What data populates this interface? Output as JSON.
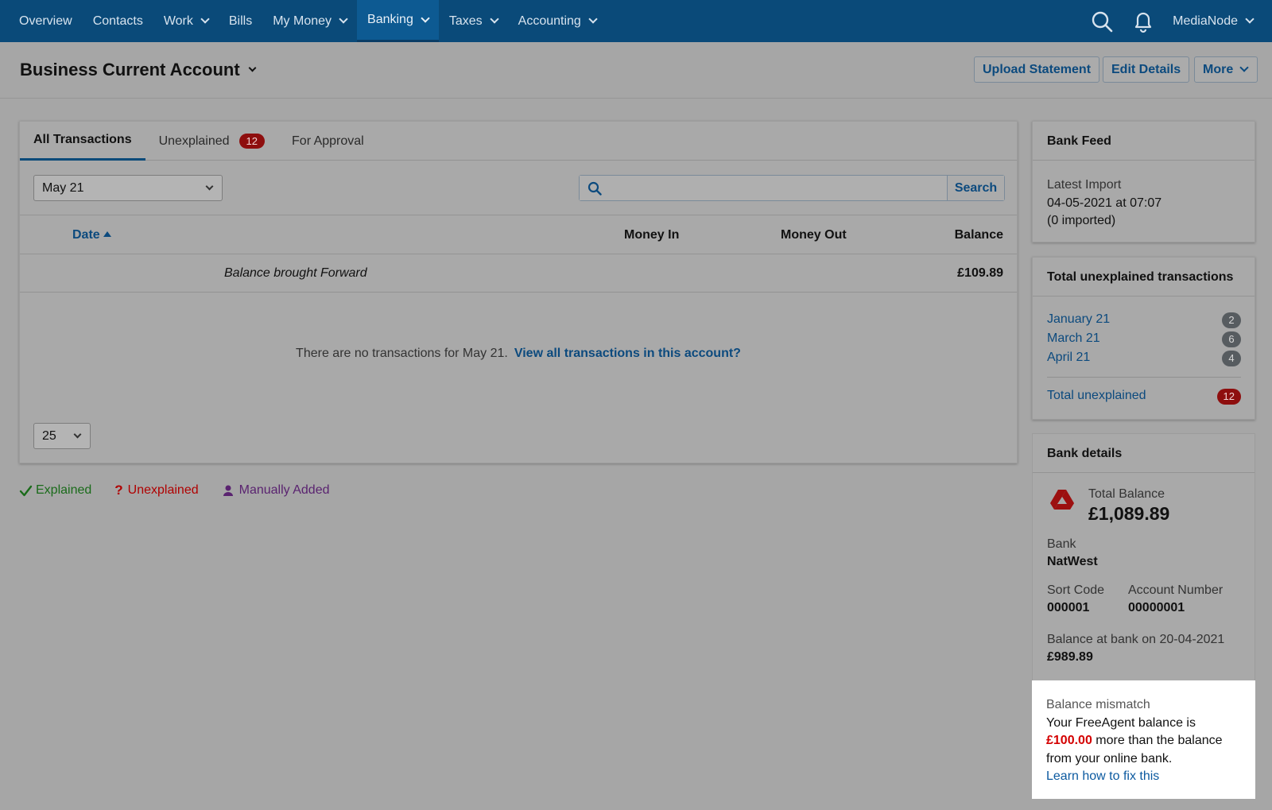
{
  "nav": {
    "items": [
      {
        "label": "Overview",
        "dropdown": false
      },
      {
        "label": "Contacts",
        "dropdown": false
      },
      {
        "label": "Work",
        "dropdown": true
      },
      {
        "label": "Bills",
        "dropdown": false
      },
      {
        "label": "My Money",
        "dropdown": true
      },
      {
        "label": "Banking",
        "dropdown": true,
        "active": true
      },
      {
        "label": "Taxes",
        "dropdown": true
      },
      {
        "label": "Accounting",
        "dropdown": true
      }
    ],
    "user": "MediaNode",
    "icons": [
      "search-icon",
      "bell-icon"
    ]
  },
  "header": {
    "title": "Business Current Account",
    "buttons": {
      "upload": "Upload Statement",
      "edit": "Edit Details",
      "more": "More"
    }
  },
  "tabs": {
    "all": "All Transactions",
    "unexplained": "Unexplained",
    "unexplained_count": "12",
    "approval": "For Approval"
  },
  "filters": {
    "month": "May 21",
    "search_placeholder": "",
    "search_button": "Search"
  },
  "table": {
    "columns": {
      "date": "Date",
      "money_in": "Money In",
      "money_out": "Money Out",
      "balance": "Balance"
    },
    "brought_forward_label": "Balance brought Forward",
    "brought_forward_value": "£109.89",
    "empty_text": "There are no transactions for May 21.",
    "empty_link": "View all transactions in this account?",
    "per_page": "25"
  },
  "legend": {
    "explained": "Explained",
    "unexplained": "Unexplained",
    "manual": "Manually Added"
  },
  "bank_feed": {
    "title": "Bank Feed",
    "latest_label": "Latest Import",
    "latest_value": "04-05-2021 at 07:07",
    "imported": "(0 imported)"
  },
  "unexplained": {
    "title": "Total unexplained transactions",
    "rows": [
      {
        "label": "January 21",
        "count": "2"
      },
      {
        "label": "March 21",
        "count": "6"
      },
      {
        "label": "April 21",
        "count": "4"
      }
    ],
    "total_label": "Total unexplained",
    "total_count": "12"
  },
  "bank_details": {
    "title": "Bank details",
    "total_balance_label": "Total Balance",
    "total_balance": "£1,089.89",
    "bank_label": "Bank",
    "bank": "NatWest",
    "sort_code_label": "Sort Code",
    "sort_code": "000001",
    "account_number_label": "Account Number",
    "account_number": "00000001",
    "bank_balance_label": "Balance at bank on 20-04-2021",
    "bank_balance": "£989.89"
  },
  "mismatch": {
    "title": "Balance mismatch",
    "text_before": "Your FreeAgent balance is",
    "amount": "£100.00",
    "text_after": "more than the balance from your online bank.",
    "link": "Learn how to fix this"
  },
  "colors": {
    "nav_bg": "#0a4a79",
    "link": "#0c4a7e",
    "badge_red": "#8e0e0e",
    "explained_green": "#1a6b1a",
    "unexplained_red": "#b00000",
    "manual_purple": "#5a2370",
    "mismatch_red": "#d40000"
  }
}
